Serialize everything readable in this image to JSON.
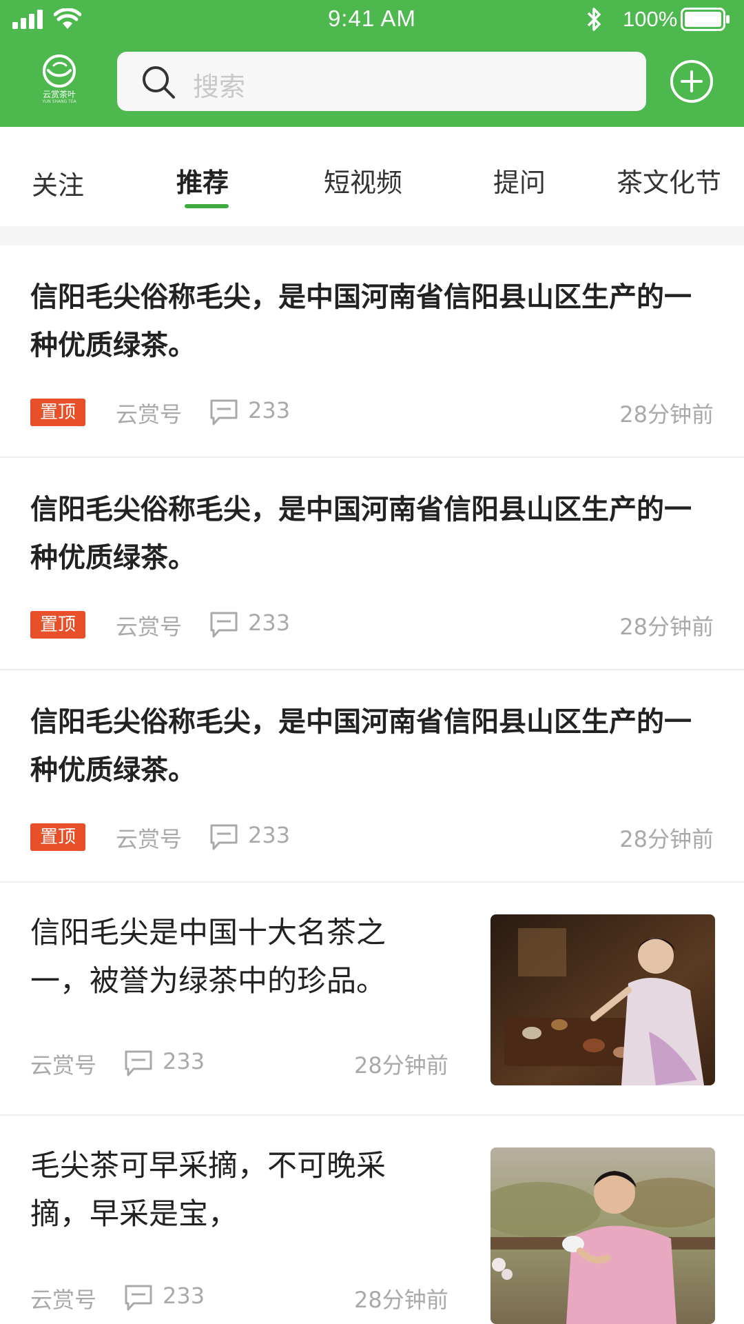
{
  "status_bar": {
    "time": "9:41 AM",
    "battery": "100%"
  },
  "header": {
    "logo_text": "云赏茶叶",
    "logo_sub": "YUN SHANG TEA",
    "search_placeholder": "搜索"
  },
  "tabs": [
    {
      "label": "关注",
      "active": false
    },
    {
      "label": "推荐",
      "active": true
    },
    {
      "label": "短视频",
      "active": false
    },
    {
      "label": "提问",
      "active": false
    },
    {
      "label": "茶文化节",
      "active": false
    }
  ],
  "feed": {
    "text_items": [
      {
        "title": "信阳毛尖俗称毛尖，是中国河南省信阳县山区生产的一种优质绿茶。",
        "badge": "置顶",
        "source": "云赏号",
        "comments": "233",
        "time": "28分钟前"
      },
      {
        "title": "信阳毛尖俗称毛尖，是中国河南省信阳县山区生产的一种优质绿茶。",
        "badge": "置顶",
        "source": "云赏号",
        "comments": "233",
        "time": "28分钟前"
      },
      {
        "title": "信阳毛尖俗称毛尖，是中国河南省信阳县山区生产的一种优质绿茶。",
        "badge": "置顶",
        "source": "云赏号",
        "comments": "233",
        "time": "28分钟前"
      }
    ],
    "image_items": [
      {
        "title": "信阳毛尖是中国十大名茶之一，被誉为绿茶中的珍品。",
        "source": "云赏号",
        "comments": "233",
        "time": "28分钟前",
        "image": "woman-tea-ceremony-photo"
      },
      {
        "title": "毛尖茶可早采摘，不可晚采摘，早采是宝，",
        "source": "云赏号",
        "comments": "233",
        "time": "28分钟前",
        "image": "man-drinking-tea-photo"
      }
    ]
  },
  "colors": {
    "brand": "#4cb84d",
    "badge": "#e8502a",
    "meta": "#a9a9a9"
  }
}
